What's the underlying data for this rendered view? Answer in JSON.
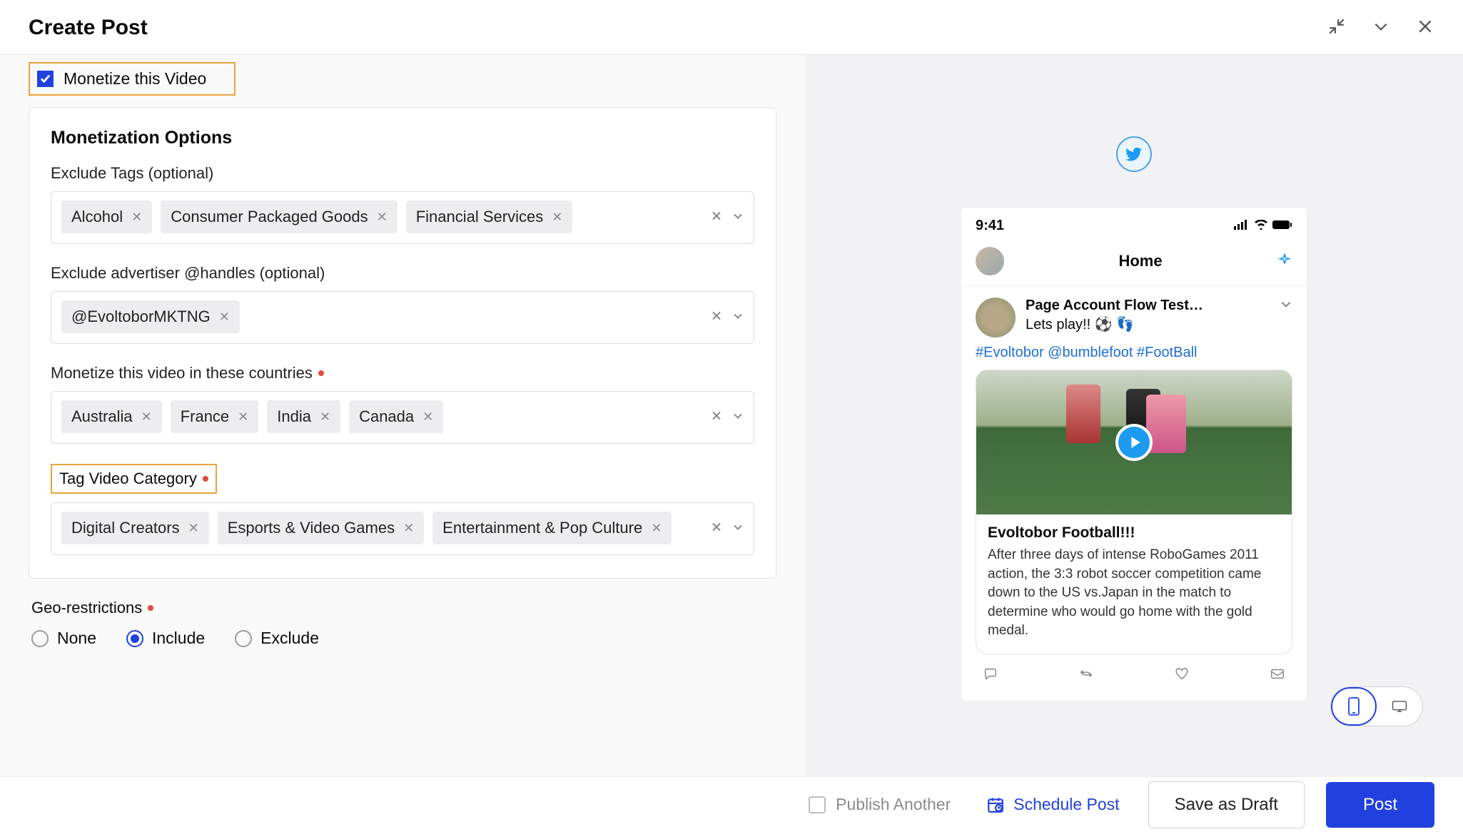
{
  "header": {
    "title": "Create Post"
  },
  "monetize": {
    "checkbox_label": "Monetize this Video",
    "options_title": "Monetization Options",
    "exclude_tags_label": "Exclude Tags (optional)",
    "exclude_tags": [
      "Alcohol",
      "Consumer Packaged Goods",
      "Financial Services"
    ],
    "exclude_handles_label": "Exclude advertiser @handles (optional)",
    "exclude_handles": [
      "@EvoltoborMKTNG"
    ],
    "countries_label": "Monetize this video in these countries",
    "countries": [
      "Australia",
      "France",
      "India",
      "Canada"
    ],
    "tag_category_label": "Tag Video Category",
    "categories": [
      "Digital Creators",
      "Esports & Video Games",
      "Entertainment & Pop Culture"
    ]
  },
  "geo": {
    "title": "Geo-restrictions",
    "options": {
      "none": "None",
      "include": "Include",
      "exclude": "Exclude"
    },
    "selected": "include"
  },
  "preview": {
    "status_time": "9:41",
    "home_label": "Home",
    "account_name": "Page Account Flow Test…",
    "caption": "Lets play!! ⚽ 👣",
    "hashtags": "#Evoltobor @bumblefoot #FootBall",
    "card_title": "Evoltobor Football!!!",
    "card_desc": "After three days of intense RoboGames 2011 action, the 3:3 robot soccer competition came down to the US vs.Japan in the match to determine who would go home with the gold medal."
  },
  "footer": {
    "publish_another": "Publish Another",
    "schedule": "Schedule Post",
    "save_draft": "Save as Draft",
    "post": "Post"
  }
}
